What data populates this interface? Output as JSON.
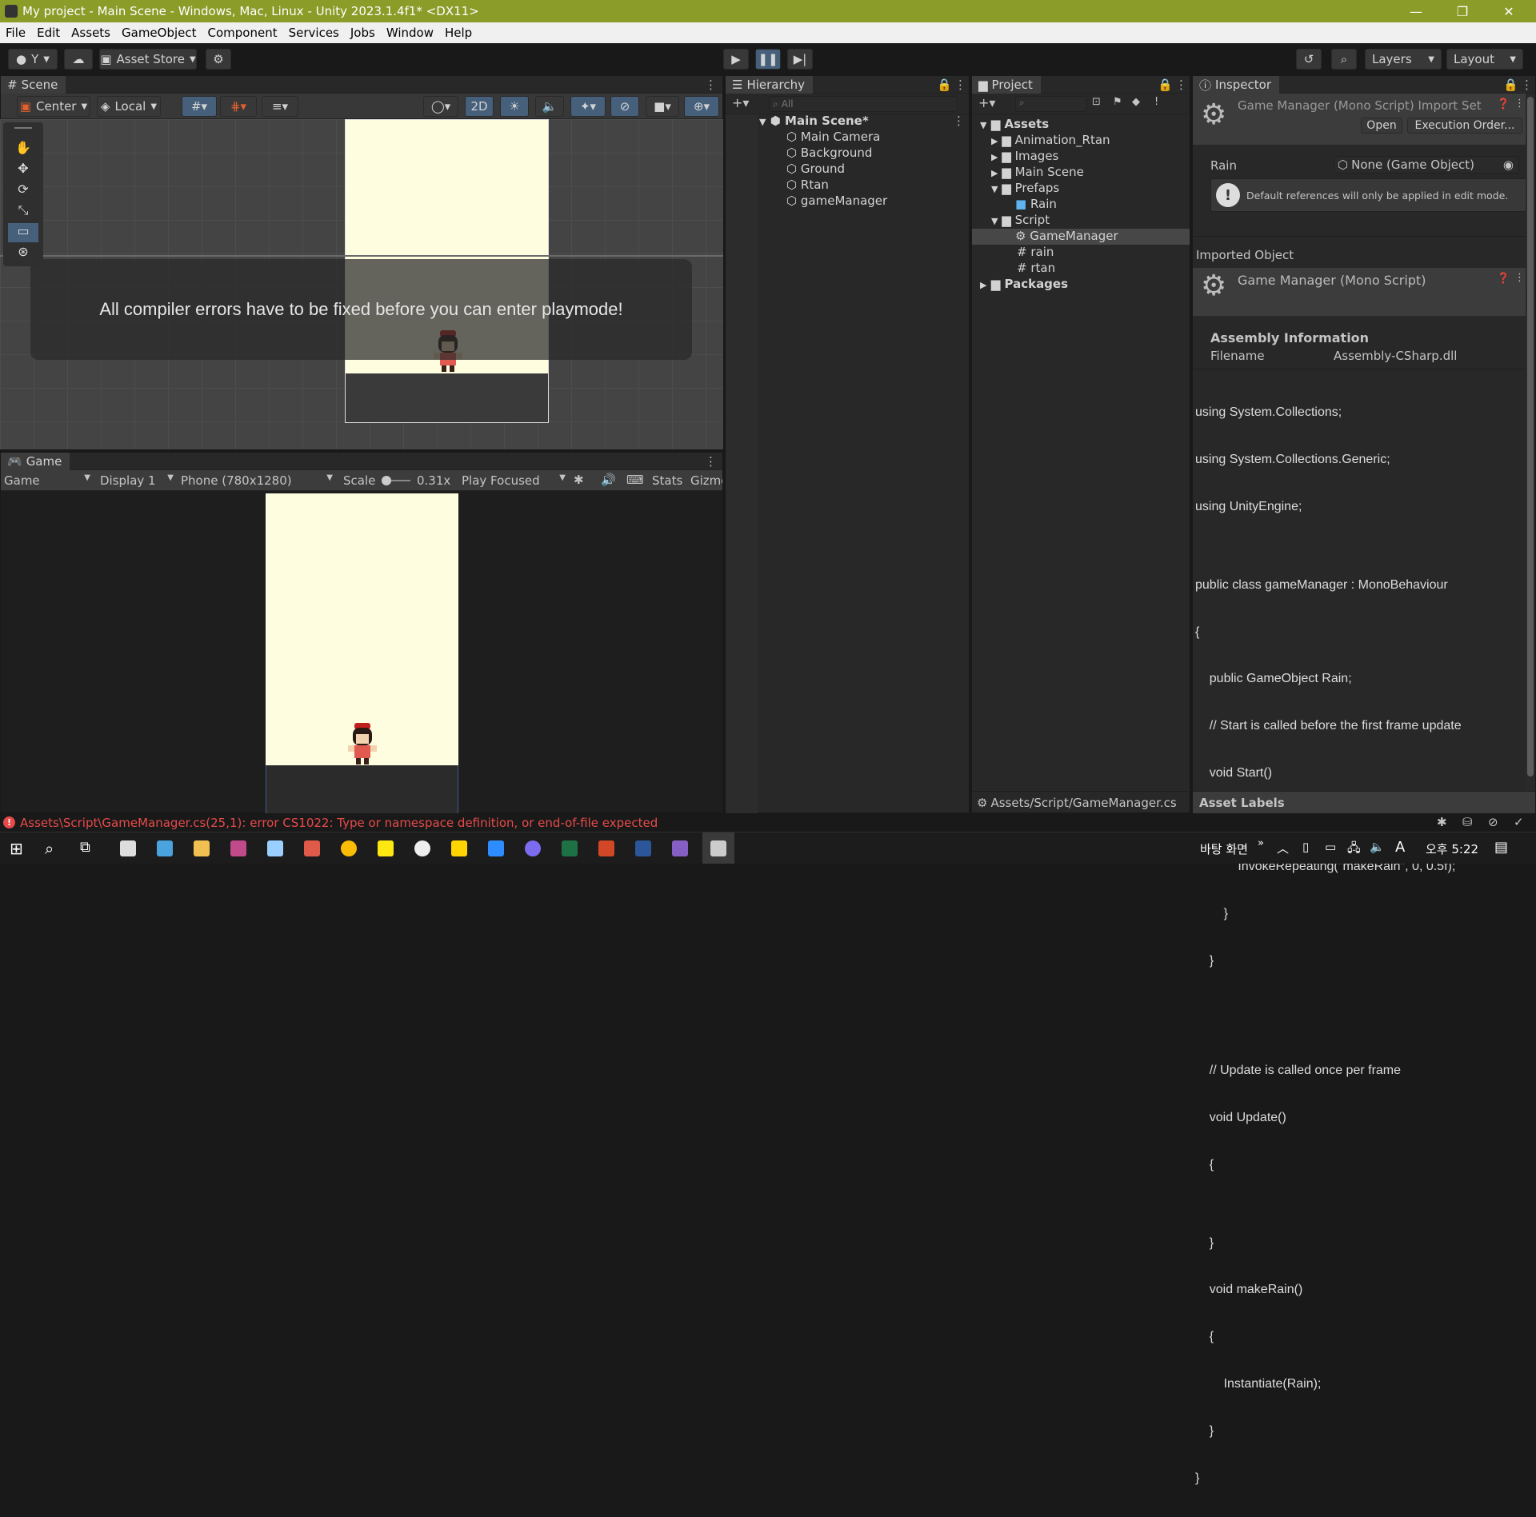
{
  "window": {
    "title": "My project - Main Scene - Windows, Mac, Linux - Unity 2023.1.4f1* <DX11>",
    "controls": [
      "—",
      "❐",
      "✕"
    ]
  },
  "menu": [
    "File",
    "Edit",
    "Assets",
    "GameObject",
    "Component",
    "Services",
    "Jobs",
    "Window",
    "Help"
  ],
  "toolbar": {
    "account_label": "Y",
    "asset_store_label": "Asset Store",
    "layers_label": "Layers",
    "layout_label": "Layout"
  },
  "scene": {
    "tab_label": "Scene",
    "pivot_label": "Center",
    "space_label": "Local",
    "mode_2d_label": "2D",
    "overlay_message": "All compiler errors have to be fixed before you can enter playmode!"
  },
  "game": {
    "tab_label": "Game",
    "view_select": "Game",
    "display_select": "Display 1",
    "resolution_select": "Phone (780x1280)",
    "scale_label": "Scale",
    "scale_value": "0.31x",
    "play_mode_select": "Play Focused",
    "stats_label": "Stats",
    "gizmos_label": "Gizmo"
  },
  "hierarchy": {
    "tab_label": "Hierarchy",
    "search_placeholder": "All",
    "scene_name": "Main Scene*",
    "items": [
      "Main Camera",
      "Background",
      "Ground",
      "Rtan",
      "gameManager"
    ]
  },
  "project": {
    "tab_label": "Project",
    "assets_label": "Assets",
    "folders": [
      "Animation_Rtan",
      "Images",
      "Main Scene",
      "Prefaps"
    ],
    "prefaps_children": [
      "Rain"
    ],
    "script_folder": "Script",
    "script_children": [
      "GameManager",
      "rain",
      "rtan"
    ],
    "packages_label": "Packages",
    "footer_path": "Assets/Script/GameManager.cs"
  },
  "inspector": {
    "tab_label": "Inspector",
    "header_title": "Game Manager (Mono Script) Import Set",
    "open_button": "Open",
    "execution_order_button": "Execution Order...",
    "field_label": "Rain",
    "field_value": "None (Game Object)",
    "info_message": "Default references will only be applied in edit mode.",
    "imported_object_label": "Imported Object",
    "imported_title": "Game Manager (Mono Script)",
    "assembly_header": "Assembly Information",
    "filename_label": "Filename",
    "filename_value": "Assembly-CSharp.dll",
    "code_lines": [
      "using System.Collections;",
      "using System.Collections.Generic;",
      "using UnityEngine;",
      "",
      "public class gameManager : MonoBehaviour",
      "{",
      "    public GameObject Rain;",
      "    // Start is called before the first frame update",
      "    void Start()",
      "        {",
      "            InvokeRepeating(\"makeRain\", 0, 0.5f);",
      "        }",
      "    }",
      "",
      "",
      "    // Update is called once per frame",
      "    void Update()",
      "    {",
      "",
      "    }",
      "    void makeRain()",
      "    {",
      "        Instantiate(Rain);",
      "    }",
      "}"
    ],
    "asset_labels": "Asset Labels"
  },
  "status": {
    "error_text": "Assets\\Script\\GameManager.cs(25,1): error CS1022: Type or namespace definition, or end-of-file expected"
  },
  "taskbar": {
    "desktop_label": "바탕 화면",
    "ime_label": "A",
    "clock": "오후 5:22"
  },
  "colors": {
    "title_bar": "#8b9c28",
    "error_red": "#e74a4a",
    "selection": "#3e5f8a",
    "game_background": "#fffde0"
  }
}
